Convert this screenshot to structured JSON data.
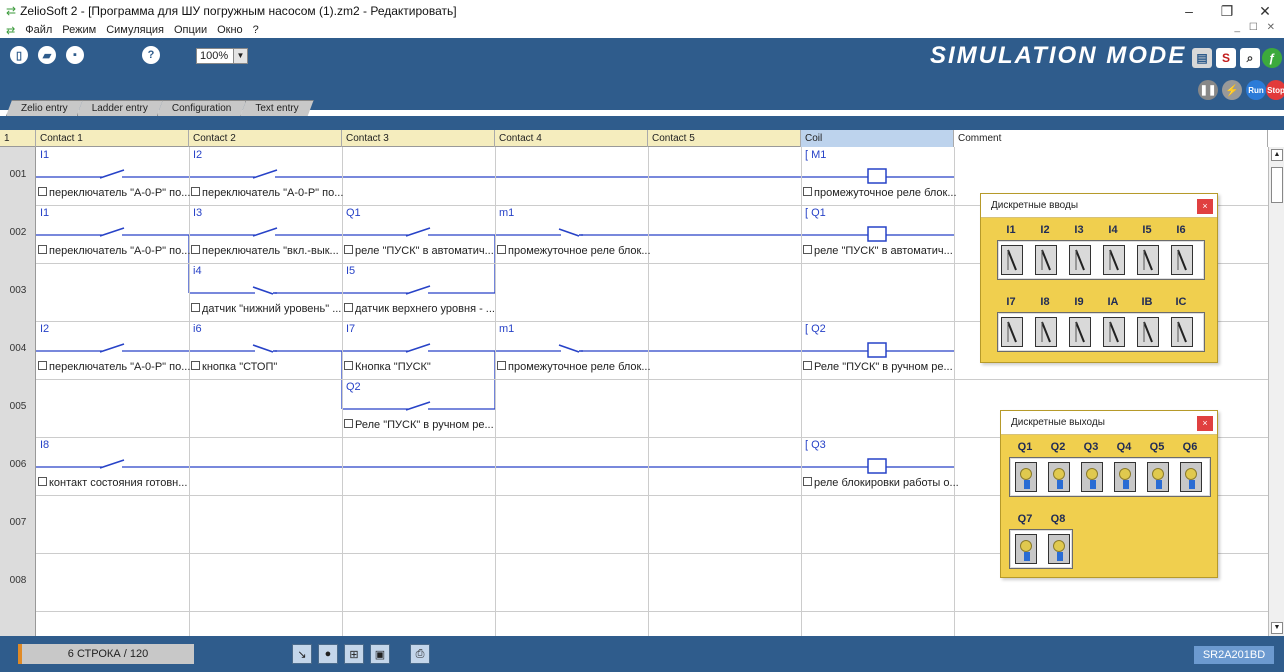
{
  "window": {
    "title": "ZelioSoft 2 - [Программа для ШУ погружным насосом (1).zm2 - Редактировать]",
    "controls": [
      "–",
      "❐",
      "✕"
    ]
  },
  "menu": {
    "items": [
      "Файл",
      "Режим",
      "Симуляция",
      "Опции",
      "Окно",
      "?"
    ],
    "child_controls": "_ ☐ ✕"
  },
  "toolbar": {
    "zoom": "100%",
    "mode_title": "SIMULATION MODE",
    "s_button": "S",
    "run": "Run",
    "stop": "Stop"
  },
  "tabs": [
    "Zelio entry",
    "Ladder entry",
    "Configuration",
    "Text entry"
  ],
  "grid": {
    "corner": "1",
    "columns": [
      "Contact 1",
      "Contact 2",
      "Contact 3",
      "Contact 4",
      "Contact 5",
      "Coil",
      "Comment"
    ],
    "rows": [
      "001",
      "002",
      "003",
      "004",
      "005",
      "006",
      "007",
      "008"
    ],
    "contacts": [
      {
        "label": "I1",
        "desc": "переключатель \"А-0-Р\" по...",
        "col": 0,
        "row": 0,
        "type": "no"
      },
      {
        "label": "I2",
        "desc": "переключатель \"А-0-Р\" по...",
        "col": 1,
        "row": 0,
        "type": "no"
      },
      {
        "label": "I1",
        "desc": "переключатель \"А-0-Р\" по...",
        "col": 0,
        "row": 1,
        "type": "no"
      },
      {
        "label": "I3",
        "desc": "переключатель \"вкл.-вык...",
        "col": 1,
        "row": 1,
        "type": "no"
      },
      {
        "label": "Q1",
        "desc": "реле \"ПУСК\" в автоматич...",
        "col": 2,
        "row": 1,
        "type": "no"
      },
      {
        "label": "m1",
        "desc": "промежуточное реле блок...",
        "col": 3,
        "row": 1,
        "type": "nc"
      },
      {
        "label": "i4",
        "desc": "датчик \"нижний уровень\" ...",
        "col": 1,
        "row": 2,
        "type": "nc"
      },
      {
        "label": "I5",
        "desc": "датчик верхнего уровня - ...",
        "col": 2,
        "row": 2,
        "type": "no"
      },
      {
        "label": "I2",
        "desc": "переключатель \"А-0-Р\" по...",
        "col": 0,
        "row": 3,
        "type": "no"
      },
      {
        "label": "i6",
        "desc": "кнопка \"СТОП\"",
        "col": 1,
        "row": 3,
        "type": "nc"
      },
      {
        "label": "I7",
        "desc": "Кнопка \"ПУСК\"",
        "col": 2,
        "row": 3,
        "type": "no"
      },
      {
        "label": "m1",
        "desc": "промежуточное реле блок...",
        "col": 3,
        "row": 3,
        "type": "nc"
      },
      {
        "label": "Q2",
        "desc": "Реле \"ПУСК\" в ручном ре...",
        "col": 2,
        "row": 4,
        "type": "no"
      },
      {
        "label": "I8",
        "desc": "контакт состояния готовн...",
        "col": 0,
        "row": 5,
        "type": "no"
      }
    ],
    "coils": [
      {
        "label": "[ M1",
        "desc": "промежуточное реле блок...",
        "row": 0
      },
      {
        "label": "[ Q1",
        "desc": "реле \"ПУСК\" в автоматич...",
        "row": 1
      },
      {
        "label": "[ Q2",
        "desc": "Реле \"ПУСК\" в ручном ре...",
        "row": 3
      },
      {
        "label": "[ Q3",
        "desc": "реле блокировки работы о...",
        "row": 5
      }
    ]
  },
  "inputs_panel": {
    "title": "Дискретные вводы",
    "close": "×",
    "row1": [
      "I1",
      "I2",
      "I3",
      "I4",
      "I5",
      "I6"
    ],
    "row2": [
      "I7",
      "I8",
      "I9",
      "IA",
      "IB",
      "IC"
    ]
  },
  "outputs_panel": {
    "title": "Дискретные выходы",
    "close": "×",
    "row1": [
      "Q1",
      "Q2",
      "Q3",
      "Q4",
      "Q5",
      "Q6"
    ],
    "row2": [
      "Q7",
      "Q8"
    ]
  },
  "status": {
    "line": "6 СТРОКА / 120",
    "module": "SR2A201BD"
  }
}
